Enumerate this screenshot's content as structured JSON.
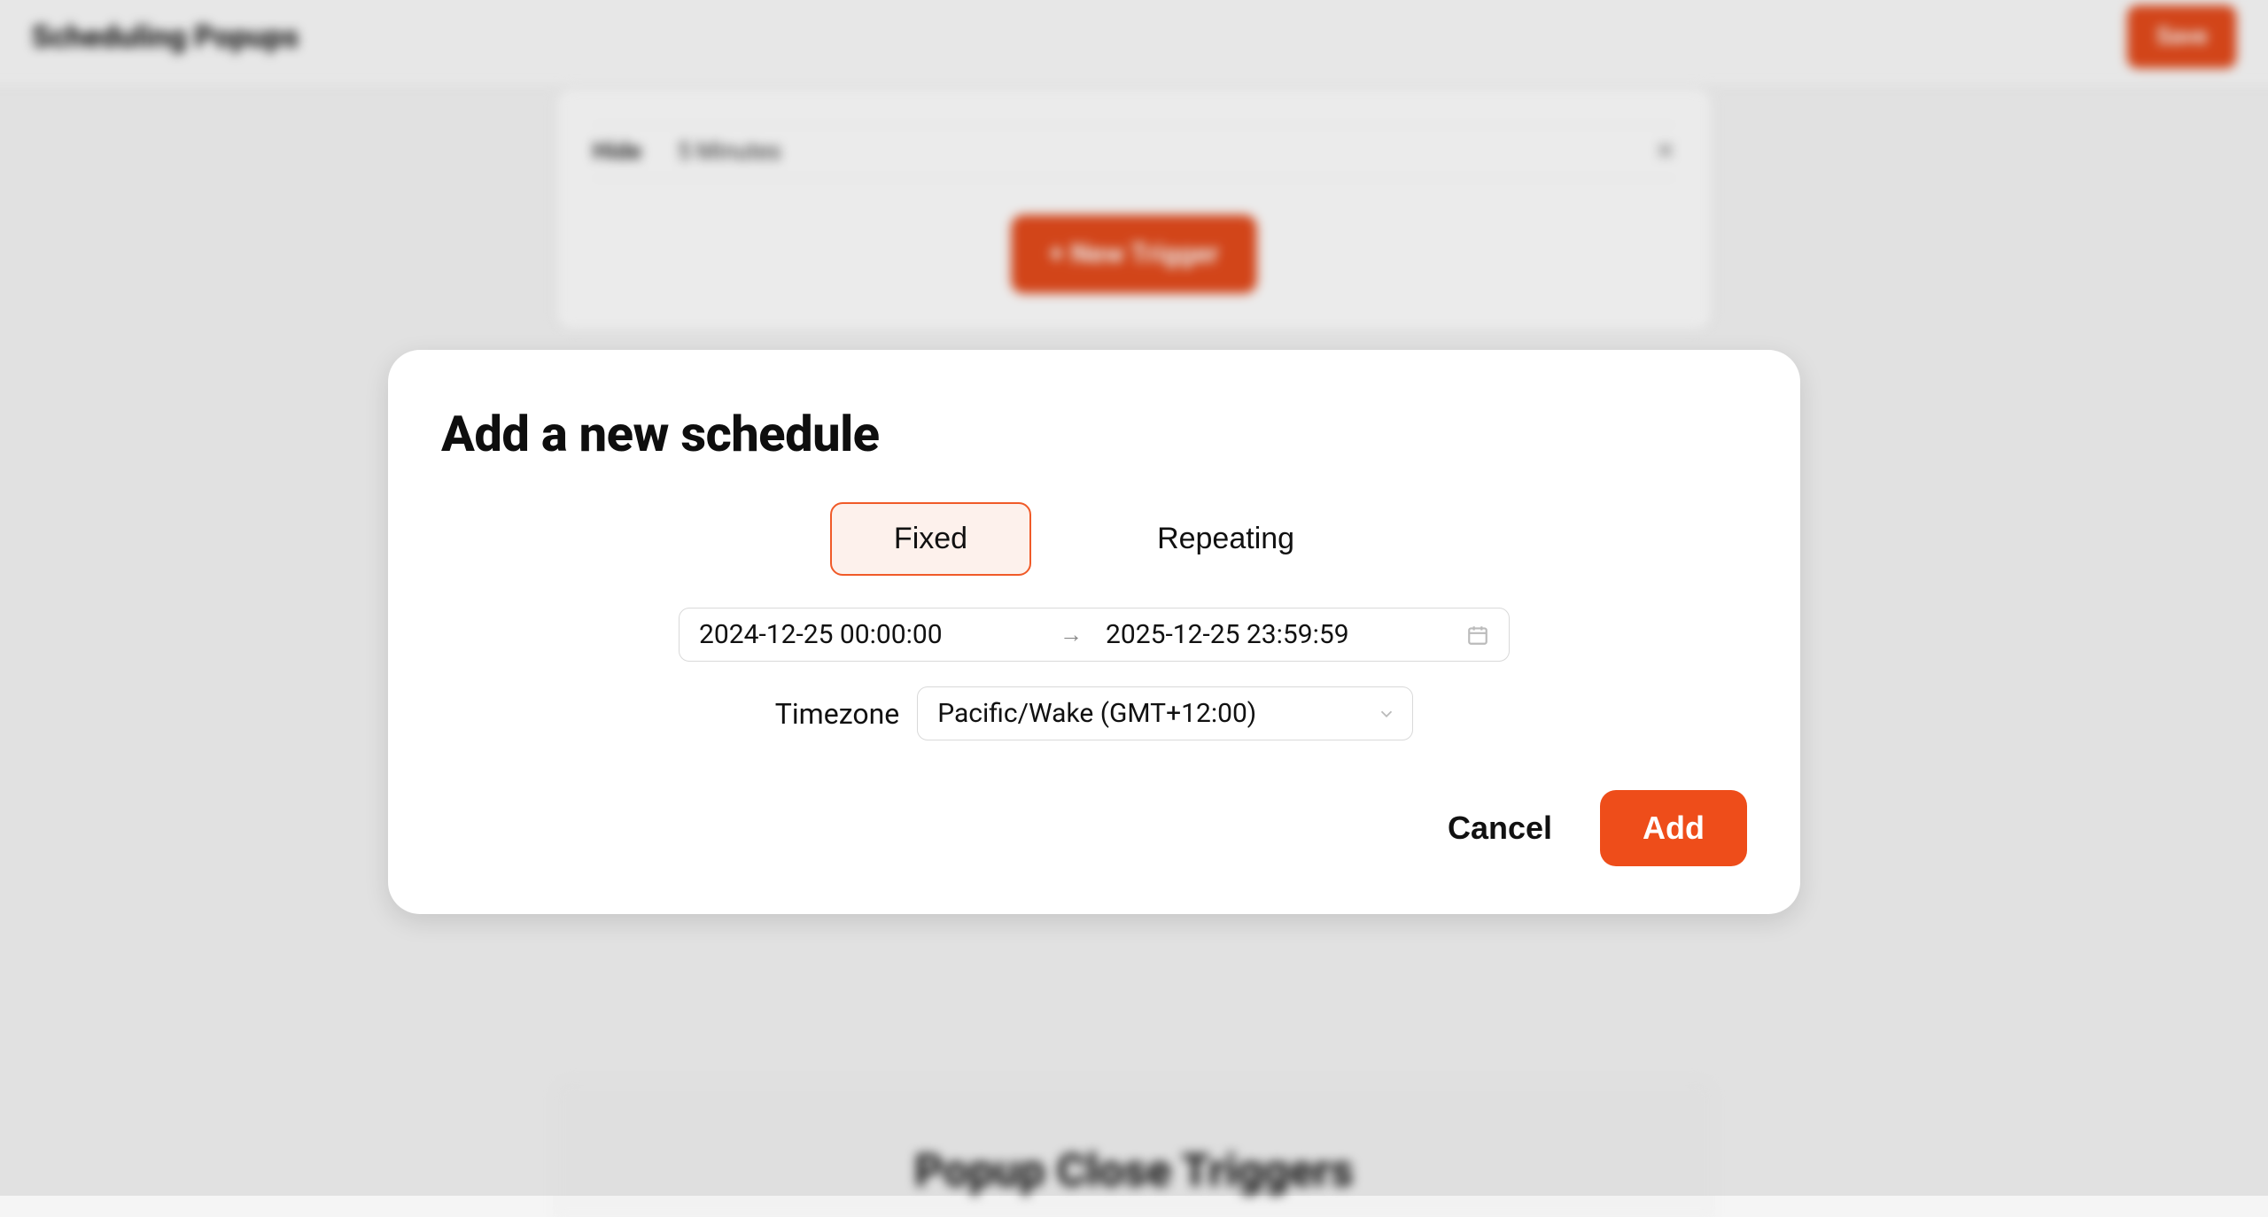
{
  "colors": {
    "accent": "#ee4d1a",
    "accent_bg_soft": "#fdf1ec"
  },
  "background": {
    "page_title": "Scheduling Popups",
    "header_button": "Save",
    "card_row_left_a": "Hide",
    "card_row_left_b": "5 Minutes",
    "new_trigger_button": "+ New Trigger",
    "section_title": "Popup Close Triggers"
  },
  "modal": {
    "title": "Add a new schedule",
    "tabs": {
      "fixed": "Fixed",
      "repeating": "Repeating"
    },
    "date_range": {
      "start": "2024-12-25 00:00:00",
      "end": "2025-12-25 23:59:59"
    },
    "timezone": {
      "label": "Timezone",
      "selected": "Pacific/Wake (GMT+12:00)"
    },
    "buttons": {
      "cancel": "Cancel",
      "add": "Add"
    }
  }
}
